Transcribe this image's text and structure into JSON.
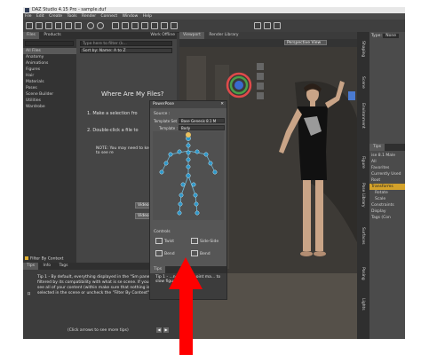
{
  "window": {
    "title": "DAZ Studio 4.15 Pro - sample.duf"
  },
  "menu": [
    "File",
    "Edit",
    "Create",
    "Tools",
    "Render",
    "Connect",
    "Window",
    "Help"
  ],
  "left_panel": {
    "tabs": [
      "Files",
      "Products"
    ],
    "extra_tab": "Work Offline",
    "search_placeholder": "Type here to filter (k...",
    "sort_label": "Sort by: Name: A to Z",
    "categories": [
      "All Files",
      "Anatomy",
      "Animations",
      "Figures",
      "Hair",
      "Materials",
      "Poses",
      "Scene Builder",
      "Utilities",
      "Wardrobe"
    ],
    "heading": "Where Are My Files?",
    "step1": "1. Make a selection fro",
    "step2": "2. Double-click a file to",
    "note": "NOTE: You may need to keyword filter to see re",
    "video_buttons": [
      "Video: Files",
      "Video: Produ"
    ],
    "filter_checkbox": "Filter By Context"
  },
  "tips_panel": {
    "tabs": [
      "Tips",
      "Info",
      "Tags"
    ],
    "text": "Tip 1 - By default, everything displayed in the \"Sm pane is filtered by its compatibility with what is se scene. If you want to see all of your content (within make sure that nothing is selected in the scene or uncheck the \"Filter By Context\" option.",
    "footer": "(Click arrows to see more tips)"
  },
  "viewport": {
    "tabs": [
      "Viewport",
      "Render Library"
    ],
    "camera": "Perspective View"
  },
  "right_panel": {
    "type_label": "Type:",
    "type_value": "None",
    "tab": "Tips",
    "rows": [
      "ise 8.1 Male",
      "All",
      "Favorites",
      "Currently Used",
      "Root",
      "Transforms",
      "Rotate",
      "Scale",
      "Constraints",
      "Display",
      "Tags (Con"
    ],
    "highlighted_row": "Transforms",
    "side_tabs": [
      "Shaping",
      "Scene",
      "Environment",
      "Figure",
      "Pose Library",
      "Surfaces",
      "Posing",
      "Lights"
    ]
  },
  "powerpose": {
    "title": "PowerPose",
    "source_label": "Source :",
    "template_set_label": "Template Set :",
    "template_set_value": "Base Genesis 8.1 M",
    "template_label": "Template :",
    "template_value": "Body",
    "controls_label": "Controls",
    "controls": [
      "Twist",
      "Side-Side",
      "Bend",
      "Bend"
    ],
    "tips_tab": "Tips",
    "tip_text": "Tip 1 - ...nd drag a point ma... to slow figure. Left-"
  },
  "colors": {
    "arrow": "#ff0000",
    "highlight": "#d4a22a"
  }
}
